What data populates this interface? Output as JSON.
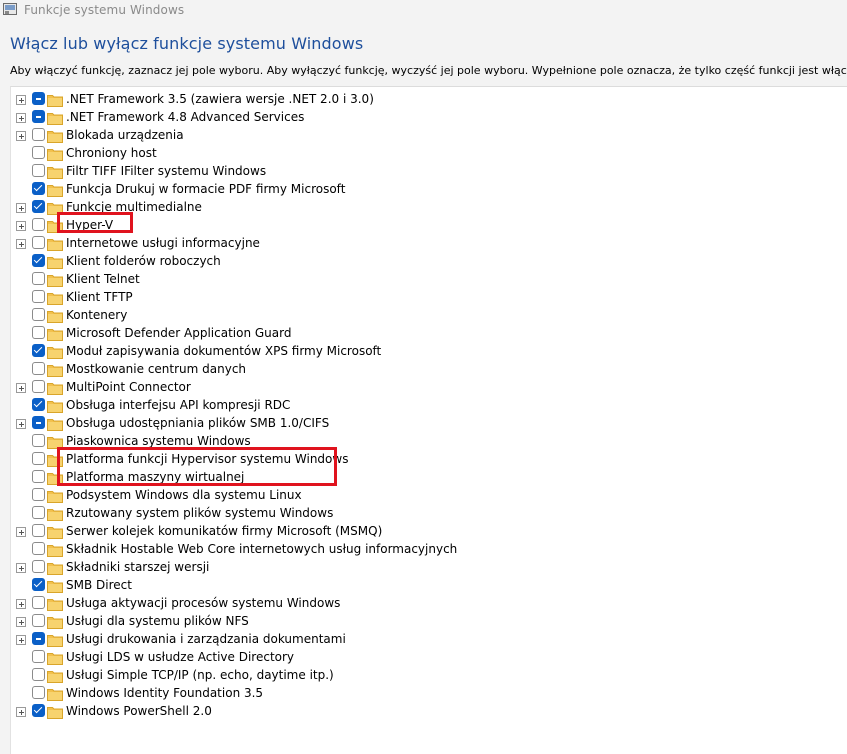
{
  "window": {
    "title": "Funkcje systemu Windows",
    "heading": "Włącz lub wyłącz funkcje systemu Windows",
    "description": "Aby włączyć funkcję, zaznacz jej pole wyboru. Aby wyłączyć funkcję, wyczyść jej pole wyboru. Wypełnione pole oznacza, że tylko część funkcji jest włączona."
  },
  "colors": {
    "accent": "#0a5fc7",
    "heading": "#1e4f9c",
    "highlight": "#e0131e",
    "folder": "#f2c14e"
  },
  "features": [
    {
      "label": ".NET Framework 3.5 (zawiera wersje .NET 2.0 i 3.0)",
      "state": "partial",
      "expandable": true
    },
    {
      "label": ".NET Framework 4.8 Advanced Services",
      "state": "partial",
      "expandable": true
    },
    {
      "label": "Blokada urządzenia",
      "state": "unchecked",
      "expandable": true
    },
    {
      "label": "Chroniony host",
      "state": "unchecked",
      "expandable": false
    },
    {
      "label": "Filtr TIFF IFilter systemu Windows",
      "state": "unchecked",
      "expandable": false
    },
    {
      "label": "Funkcja Drukuj w formacie PDF firmy Microsoft",
      "state": "checked",
      "expandable": false
    },
    {
      "label": "Funkcje multimedialne",
      "state": "checked",
      "expandable": true
    },
    {
      "label": "Hyper-V",
      "state": "unchecked",
      "expandable": true
    },
    {
      "label": "Internetowe usługi informacyjne",
      "state": "unchecked",
      "expandable": true
    },
    {
      "label": "Klient folderów roboczych",
      "state": "checked",
      "expandable": false
    },
    {
      "label": "Klient Telnet",
      "state": "unchecked",
      "expandable": false
    },
    {
      "label": "Klient TFTP",
      "state": "unchecked",
      "expandable": false
    },
    {
      "label": "Kontenery",
      "state": "unchecked",
      "expandable": false
    },
    {
      "label": "Microsoft Defender Application Guard",
      "state": "unchecked",
      "expandable": false
    },
    {
      "label": "Moduł zapisywania dokumentów XPS firmy Microsoft",
      "state": "checked",
      "expandable": false
    },
    {
      "label": "Mostkowanie centrum danych",
      "state": "unchecked",
      "expandable": false
    },
    {
      "label": "MultiPoint Connector",
      "state": "unchecked",
      "expandable": true
    },
    {
      "label": "Obsługa interfejsu API kompresji RDC",
      "state": "checked",
      "expandable": false
    },
    {
      "label": "Obsługa udostępniania plików SMB 1.0/CIFS",
      "state": "partial",
      "expandable": true
    },
    {
      "label": "Piaskownica systemu Windows",
      "state": "unchecked",
      "expandable": false
    },
    {
      "label": "Platforma funkcji Hypervisor systemu Windows",
      "state": "unchecked",
      "expandable": false
    },
    {
      "label": "Platforma maszyny wirtualnej",
      "state": "unchecked",
      "expandable": false
    },
    {
      "label": "Podsystem Windows dla systemu Linux",
      "state": "unchecked",
      "expandable": false
    },
    {
      "label": "Rzutowany system plików systemu Windows",
      "state": "unchecked",
      "expandable": false
    },
    {
      "label": "Serwer kolejek komunikatów firmy Microsoft (MSMQ)",
      "state": "unchecked",
      "expandable": true
    },
    {
      "label": "Składnik Hostable Web Core internetowych usług informacyjnych",
      "state": "unchecked",
      "expandable": false
    },
    {
      "label": "Składniki starszej wersji",
      "state": "unchecked",
      "expandable": true
    },
    {
      "label": "SMB Direct",
      "state": "checked",
      "expandable": false
    },
    {
      "label": "Usługa aktywacji procesów systemu Windows",
      "state": "unchecked",
      "expandable": true
    },
    {
      "label": "Usługi dla systemu plików NFS",
      "state": "unchecked",
      "expandable": true
    },
    {
      "label": "Usługi drukowania i zarządzania dokumentami",
      "state": "partial",
      "expandable": true
    },
    {
      "label": "Usługi LDS w usłudze Active Directory",
      "state": "unchecked",
      "expandable": false
    },
    {
      "label": "Usługi Simple TCP/IP (np. echo, daytime itp.)",
      "state": "unchecked",
      "expandable": false
    },
    {
      "label": "Windows Identity Foundation 3.5",
      "state": "unchecked",
      "expandable": false
    },
    {
      "label": "Windows PowerShell 2.0",
      "state": "checked",
      "expandable": true
    }
  ]
}
